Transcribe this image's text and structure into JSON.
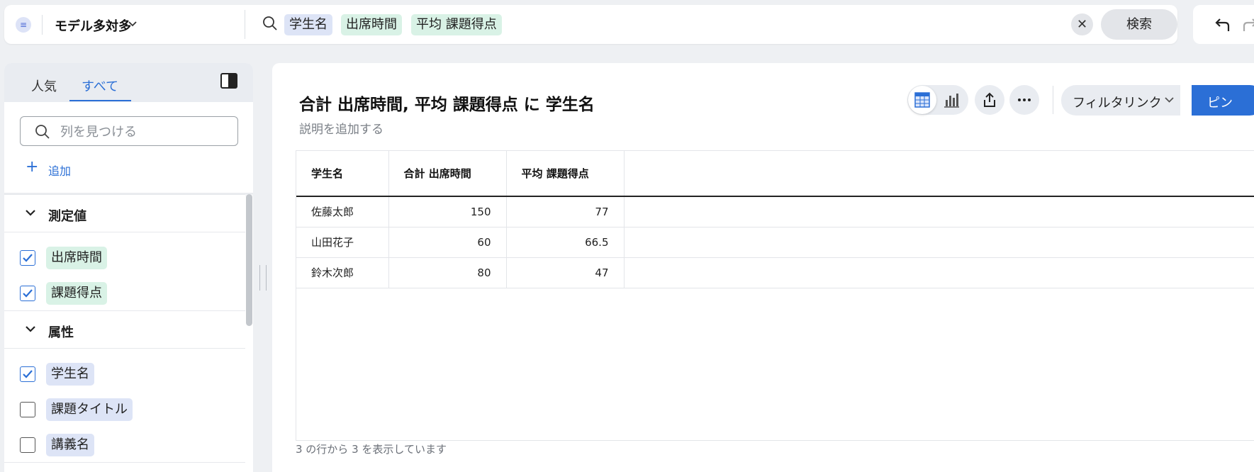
{
  "topbar": {
    "model_name": "モデル多対多",
    "search_tokens": [
      {
        "label": "学生名",
        "kind": "attribute"
      },
      {
        "label": "出席時間",
        "kind": "measure"
      },
      {
        "label": "平均 課題得点",
        "kind": "measure"
      }
    ],
    "clear_icon": "close-icon",
    "search_button": "検索"
  },
  "left_panel": {
    "tabs": [
      {
        "label": "人気",
        "active": false
      },
      {
        "label": "すべて",
        "active": true
      }
    ],
    "find_placeholder": "列を見つける",
    "add_label": "追加",
    "measures_section": {
      "label": "測定値",
      "items": [
        {
          "label": "出席時間",
          "checked": true
        },
        {
          "label": "課題得点",
          "checked": true
        }
      ]
    },
    "attributes_section": {
      "label": "属性",
      "items": [
        {
          "label": "学生名",
          "checked": true
        },
        {
          "label": "課題タイトル",
          "checked": false
        },
        {
          "label": "講義名",
          "checked": false
        }
      ]
    }
  },
  "main": {
    "title": "合計 出席時間, 平均 課題得点 に 学生名",
    "description_placeholder": "説明を追加する",
    "filter_link_label": "フィルタリンク",
    "pin_label": "ピン",
    "table": {
      "columns": [
        "学生名",
        "合計 出席時間",
        "平均 課題得点"
      ],
      "rows": [
        [
          "佐藤太郎",
          "150",
          "77"
        ],
        [
          "山田花子",
          "60",
          "66.5"
        ],
        [
          "鈴木次郎",
          "80",
          "47"
        ]
      ]
    },
    "row_count_text": "3 の行から 3 を表示しています"
  },
  "colors": {
    "accent": "#2b6fd6",
    "attribute_chip": "#dde4f6",
    "measure_chip": "#d9f2e6",
    "background": "#eef0f3"
  }
}
